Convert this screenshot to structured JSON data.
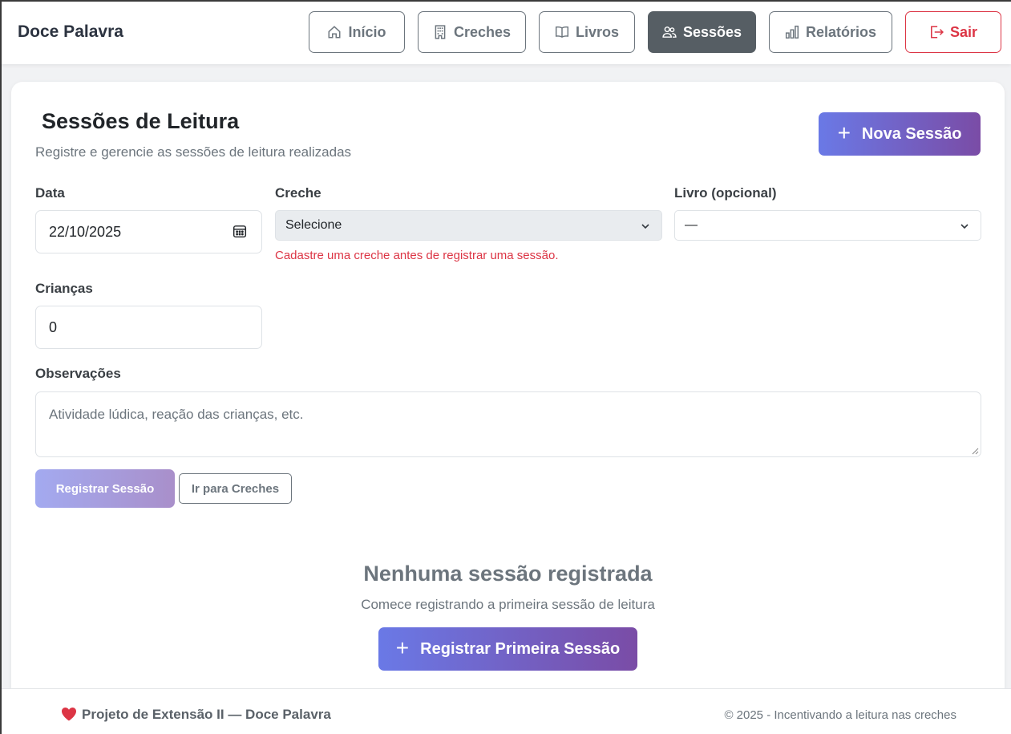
{
  "app": {
    "brand": "Doce Palavra"
  },
  "nav": {
    "inicio": "Início",
    "creches": "Creches",
    "livros": "Livros",
    "sessoes": "Sessões",
    "relatorios": "Relatórios",
    "sair": "Sair"
  },
  "page": {
    "title": "Sessões de Leitura",
    "subtitle": "Registre e gerencie as sessões de leitura realizadas",
    "new_button": "Nova Sessão"
  },
  "form": {
    "data_label": "Data",
    "data_value": "22/10/2025",
    "creche_label": "Creche",
    "creche_value": "Selecione",
    "creche_error": "Cadastre uma creche antes de registrar uma sessão.",
    "livro_label": "Livro (opcional)",
    "livro_value": "—",
    "criancas_label": "Crianças",
    "criancas_value": "0",
    "observacoes_label": "Observações",
    "observacoes_placeholder": "Atividade lúdica, reação das crianças, etc.",
    "register_button": "Registrar Sessão",
    "goto_creches_button": "Ir para Creches"
  },
  "empty": {
    "title": "Nenhuma sessão registrada",
    "text": "Comece registrando a primeira sessão de leitura",
    "button": "Registrar Primeira Sessão"
  },
  "footer": {
    "left": "Projeto de Extensão II — Doce Palavra",
    "right": "© 2025 - Incentivando a leitura nas creches"
  },
  "colors": {
    "accent_start": "#6a79e6",
    "accent_end": "#7a4ca6",
    "danger": "#dc3545",
    "active_nav": "#565e64"
  },
  "icons": [
    "home-icon",
    "building-icon",
    "book-icon",
    "users-icon",
    "bar-chart-icon",
    "logout-icon",
    "plus-icon",
    "calendar-icon",
    "chevron-down-icon",
    "heart-icon"
  ]
}
